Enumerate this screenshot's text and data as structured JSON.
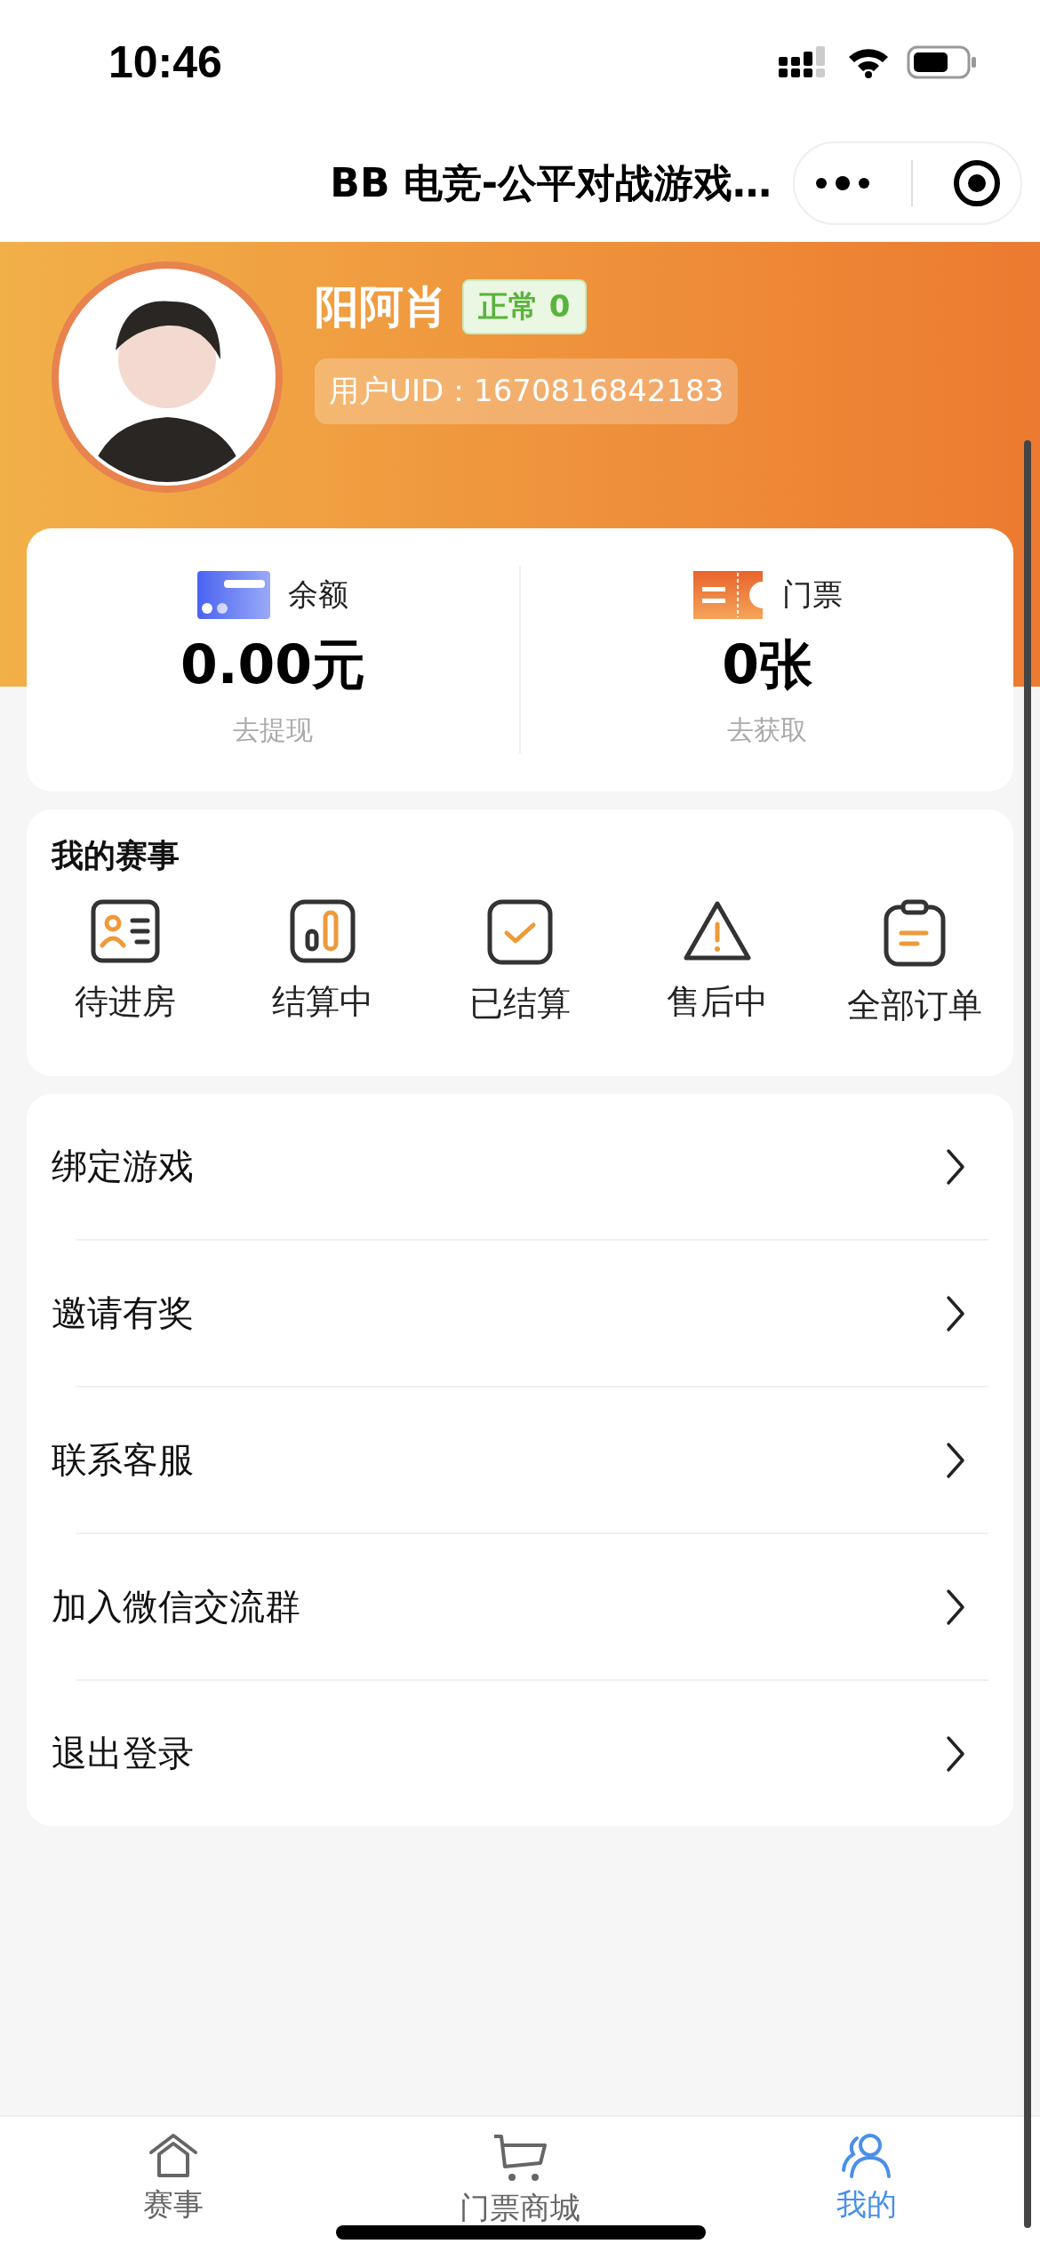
{
  "status_bar": {
    "time": "10:46"
  },
  "nav": {
    "title": "BB 电竞-公平对战游戏…"
  },
  "profile": {
    "name": "阳阿肖",
    "status_badge": "正常 0",
    "uid": "用户UID：1670816842183"
  },
  "wallet": [
    {
      "kind": "balance",
      "label": "余额",
      "value": "0.00元",
      "action": "去提现"
    },
    {
      "kind": "ticket",
      "label": "门票",
      "value": "0张",
      "action": "去获取"
    }
  ],
  "my_events": {
    "title": "我的赛事",
    "items": [
      {
        "kind": "room",
        "label": "待进房"
      },
      {
        "kind": "settling",
        "label": "结算中"
      },
      {
        "kind": "settled",
        "label": "已结算"
      },
      {
        "kind": "aftersale",
        "label": "售后中"
      },
      {
        "kind": "orders",
        "label": "全部订单"
      }
    ]
  },
  "menu": [
    "绑定游戏",
    "邀请有奖",
    "联系客服",
    "加入微信交流群",
    "退出登录"
  ],
  "tabs": [
    {
      "kind": "home",
      "label": "赛事",
      "selected": false
    },
    {
      "kind": "cart",
      "label": "门票商城",
      "selected": false
    },
    {
      "kind": "user",
      "label": "我的",
      "selected": true
    }
  ]
}
